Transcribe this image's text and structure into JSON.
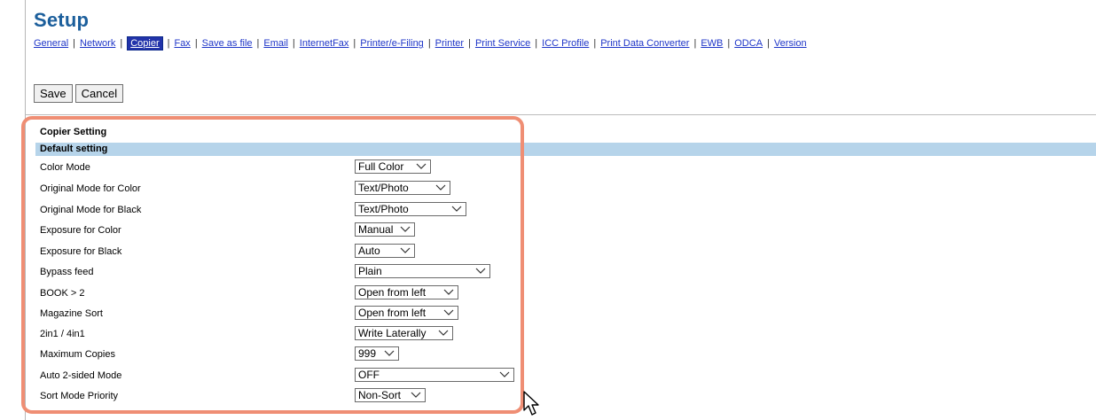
{
  "header": {
    "title": "Setup"
  },
  "tabs": [
    {
      "label": "General",
      "active": false
    },
    {
      "label": "Network",
      "active": false
    },
    {
      "label": "Copier",
      "active": true
    },
    {
      "label": "Fax",
      "active": false
    },
    {
      "label": "Save as file",
      "active": false
    },
    {
      "label": "Email",
      "active": false
    },
    {
      "label": "InternetFax",
      "active": false
    },
    {
      "label": "Printer/e-Filing",
      "active": false
    },
    {
      "label": "Printer",
      "active": false
    },
    {
      "label": "Print Service",
      "active": false
    },
    {
      "label": "ICC Profile",
      "active": false
    },
    {
      "label": "Print Data Converter",
      "active": false
    },
    {
      "label": "EWB",
      "active": false
    },
    {
      "label": "ODCA",
      "active": false
    },
    {
      "label": "Version",
      "active": false
    }
  ],
  "actions": {
    "save_label": "Save",
    "cancel_label": "Cancel"
  },
  "section": {
    "title": "Copier Setting",
    "subheader": "Default setting"
  },
  "settings": [
    {
      "label": "Color Mode",
      "value": "Full Color"
    },
    {
      "label": "Original Mode for Color",
      "value": "Text/Photo"
    },
    {
      "label": "Original Mode for Black",
      "value": "Text/Photo"
    },
    {
      "label": "Exposure for Color",
      "value": "Manual"
    },
    {
      "label": "Exposure for Black",
      "value": "Auto"
    },
    {
      "label": "Bypass feed",
      "value": "Plain"
    },
    {
      "label": "BOOK > 2",
      "value": "Open from left"
    },
    {
      "label": "Magazine Sort",
      "value": "Open from left"
    },
    {
      "label": "2in1 / 4in1",
      "value": "Write Laterally"
    },
    {
      "label": "Maximum Copies",
      "value": "999"
    },
    {
      "label": "Auto 2-sided Mode",
      "value": "OFF"
    },
    {
      "label": "Sort Mode Priority",
      "value": "Non-Sort"
    }
  ],
  "colors": {
    "title": "#1c5f9c",
    "link": "#1f36c8",
    "subheader_bg": "#b6d4ea",
    "highlight": "#ef8e74"
  }
}
